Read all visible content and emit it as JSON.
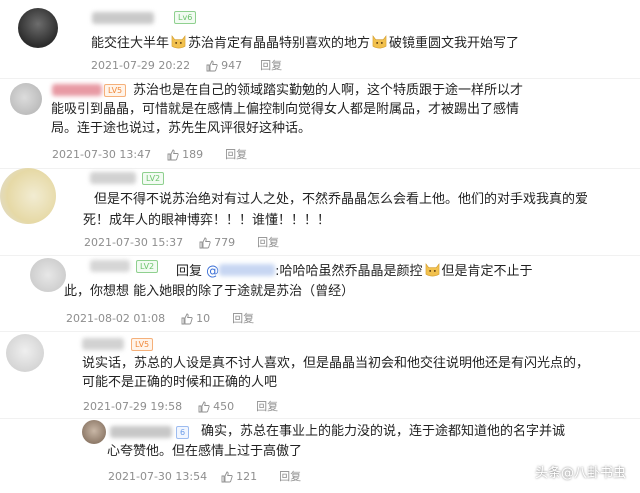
{
  "comments": [
    {
      "level": "Lv6",
      "text_1": "能交往大半年",
      "text_2": "苏治肯定有晶晶特别喜欢的地方",
      "text_3": "破镜重圆文我开始写了",
      "time": "2021-07-29 20:22",
      "likes": "947",
      "reply": "回复"
    },
    {
      "level": "LV5",
      "line1": "苏治也是在自己的领域踏实勤勉的人啊，这个特质跟于途一样所以才",
      "line2": "能吸引到晶晶，可惜就是在感情上偏控制向觉得女人都是附属品，才被踢出了感情",
      "line3": "局。连于途也说过，苏先生风评很好这种话。",
      "time": "2021-07-30 13:47",
      "likes": "189",
      "reply": "回复"
    },
    {
      "level": "LV2",
      "line1": "但是不得不说苏治绝对有过人之处，不然乔晶晶怎么会看上他。他们的对手戏我真的爱",
      "line2": "死！成年人的眼神博弈！！！谁懂！！！！",
      "time": "2021-07-30 15:37",
      "likes": "779",
      "reply": "回复"
    },
    {
      "level": "LV2",
      "reply_prefix": "回复",
      "mention": "@",
      "line1_text": ":哈哈哈虽然乔晶晶是颜控",
      "line1_tail": "但是肯定不止于",
      "line2": "此，你想想 能入她眼的除了于途就是苏治（曾经）",
      "time": "2021-08-02 01:08",
      "likes": "10",
      "reply": "回复"
    },
    {
      "level": "LV5",
      "line1": "说实话，苏总的人设是真不讨人喜欢，但是晶晶当初会和他交往说明他还是有闪光点的，",
      "line2": "可能不是正确的时候和正确的人吧",
      "time": "2021-07-29 19:58",
      "likes": "450",
      "reply": "回复"
    },
    {
      "level": "6",
      "line1": "确实，苏总在事业上的能力没的说，连于途都知道他的名字并诚",
      "line2": "心夸赞他。但在感情上过于高傲了",
      "time": "2021-07-30 13:54",
      "likes": "121",
      "reply": "回复"
    }
  ],
  "watermark": "头条@八卦书虫",
  "colors": {
    "meta_gray": "#8e8e8e",
    "mention_blue": "#3b6fd6",
    "emoji_yellow": "#f2c14e"
  }
}
